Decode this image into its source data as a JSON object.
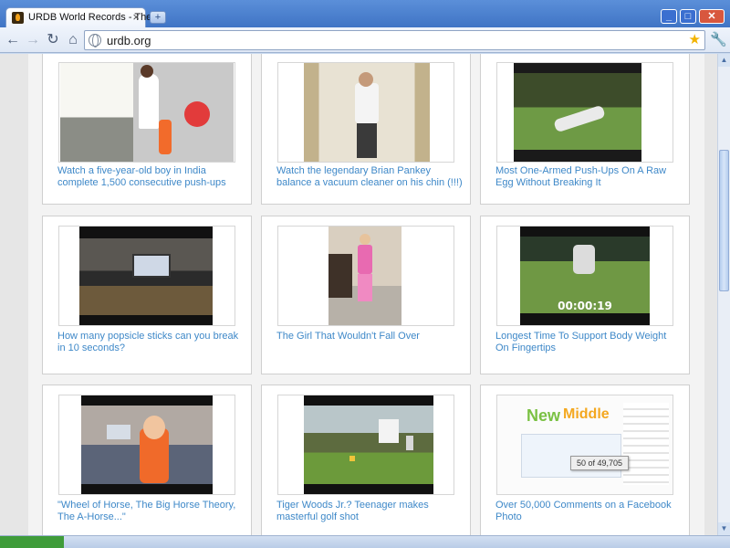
{
  "browser": {
    "tab_title": "URDB World Records - The ...",
    "tab_close": "×",
    "new_tab": "+",
    "url": "urdb.org",
    "window_buttons": {
      "minimize": "_",
      "maximize": "□",
      "close": "✕"
    },
    "icons": {
      "back": "arrow-left-icon",
      "forward": "arrow-right-icon",
      "reload": "reload-icon",
      "home": "home-icon",
      "bookmark": "star-icon",
      "menu": "wrench-icon"
    },
    "nav_glyphs": {
      "back": "←",
      "forward": "→",
      "reload": "↻",
      "home": "⌂",
      "star": "★",
      "wrench": "🔧"
    }
  },
  "videos": [
    {
      "title": "Watch a five-year-old boy in India complete 1,500 consecutive push-ups"
    },
    {
      "title": "Watch the legendary Brian Pankey balance a vacuum cleaner on his chin (!!!)"
    },
    {
      "title": "Most One-Armed Push-Ups On A Raw Egg Without Breaking It"
    },
    {
      "title": "How many popsicle sticks can you break in 10 seconds?"
    },
    {
      "title": "The Girl That Wouldn't Fall Over"
    },
    {
      "title": "Longest Time To Support Body Weight On Fingertips",
      "timecode": "00:00:19"
    },
    {
      "title": "\"Wheel of Horse, The Big Horse Theory, The A-Horse...\""
    },
    {
      "title": "Tiger Woods Jr.? Teenager makes masterful golf shot"
    },
    {
      "title": "Over 50,000 Comments on a Facebook Photo",
      "thumb_badge": "50 of 49,705",
      "thumb_word_1": "New",
      "thumb_word_2": "Middle"
    }
  ],
  "colors": {
    "link": "#3e88c8",
    "chrome_blue": "#3f74c5"
  }
}
